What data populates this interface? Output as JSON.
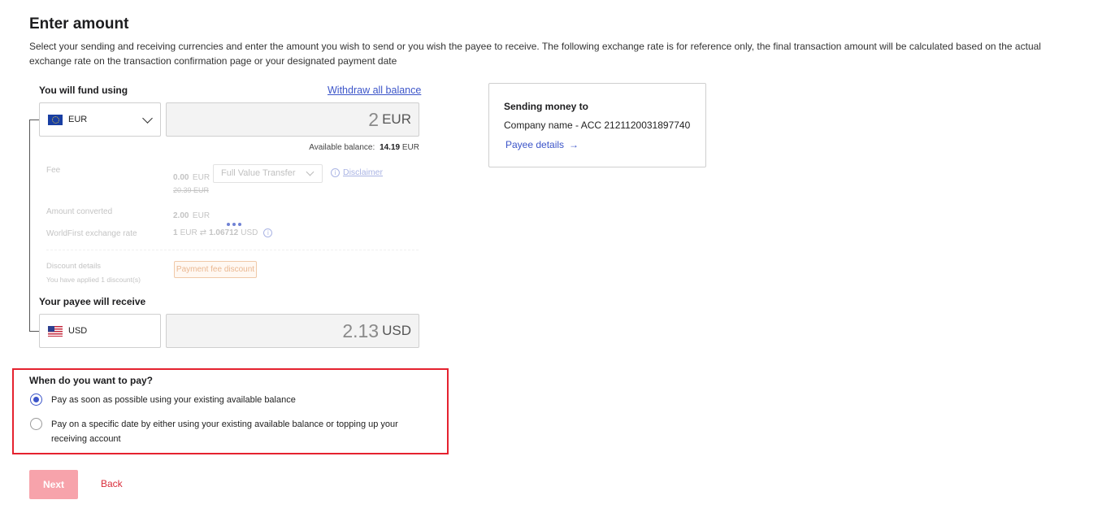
{
  "header": {
    "title": "Enter amount",
    "description": "Select your sending and receiving currencies and enter the amount you wish to send or you wish the payee to receive. The following exchange rate is for reference only, the final transaction amount will be calculated based on the actual exchange rate on the transaction confirmation page or your designated payment date"
  },
  "fund": {
    "label": "You will fund using",
    "withdraw_link": "Withdraw all balance",
    "currency": "EUR",
    "flag_icon": "eu-flag-icon",
    "amount": "2",
    "amount_currency": "EUR",
    "balance_label": "Available balance:",
    "balance_value": "14.19",
    "balance_currency": "EUR"
  },
  "details": {
    "fee_label": "Fee",
    "fee_value": "0.00",
    "fee_currency": "EUR",
    "fee_original": "20.39 EUR",
    "fee_option": "Full Value Transfer",
    "disclaimer": "Disclaimer",
    "converted_label": "Amount converted",
    "converted_value": "2.00",
    "converted_currency": "EUR",
    "rate_label": "WorldFirst exchange rate",
    "rate_from": "1",
    "rate_from_currency": "EUR",
    "rate_symbol": "⇄",
    "rate_to": "1.06712",
    "rate_to_currency": "USD",
    "discount_label": "Discount details",
    "discount_sub": "You have applied 1 discount(s)",
    "discount_tag": "Payment fee discount"
  },
  "receive": {
    "label": "Your payee will receive",
    "currency": "USD",
    "flag_icon": "us-flag-icon",
    "amount": "2.13",
    "amount_currency": "USD"
  },
  "sending_card": {
    "title": "Sending money to",
    "payee": "Company name - ACC 2121120031897740",
    "details_link": "Payee details",
    "arrow": "→"
  },
  "pay_when": {
    "question": "When do you want to pay?",
    "options": [
      {
        "label": "Pay as soon as possible using your existing available balance",
        "selected": true
      },
      {
        "label": "Pay on a specific date by either using your existing available balance or topping up your receiving account",
        "selected": false
      }
    ]
  },
  "actions": {
    "next": "Next",
    "back": "Back"
  },
  "colors": {
    "accent": "#3c55c9",
    "danger": "#e5222f",
    "next_disabled": "#f7a3ab"
  }
}
